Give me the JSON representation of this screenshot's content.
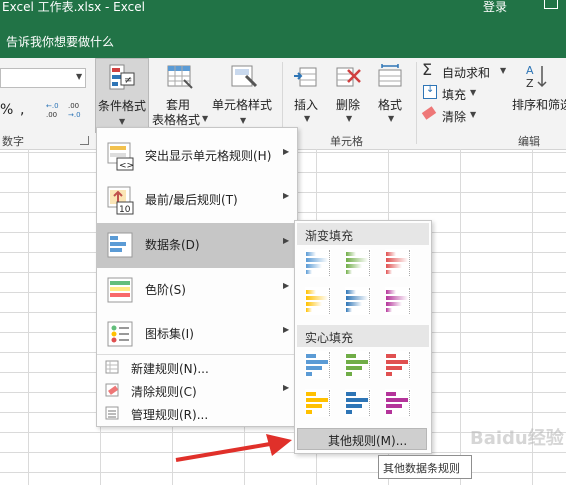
{
  "window": {
    "title": "Excel 工作表.xlsx  -  Excel",
    "login": "登录"
  },
  "tellme": {
    "text": "告诉我你想要做什么"
  },
  "ribbon": {
    "percent_symbol": "%",
    "comma_symbol": ",",
    "increase_decimal": "€.0\n.00",
    "decrease_decimal": ".00\n→.0",
    "number_group_label": "数字",
    "conditional_format": "条件格式",
    "apply_label_1": "套用",
    "apply_label_2": "表格格式",
    "cell_style": "单元格样式",
    "insert": "插入",
    "delete": "删除",
    "format": "格式",
    "cells_group_label": "单元格",
    "autosum": "自动求和",
    "fill": "填充",
    "clear": "清除",
    "sort_filter": "排序和筛选",
    "edit_group_label": "编辑"
  },
  "cf_menu": {
    "items": [
      {
        "label": "突出显示单元格规则(H)",
        "icon": "highlight-rules-icon"
      },
      {
        "label": "最前/最后规则(T)",
        "icon": "top-bottom-rules-icon"
      },
      {
        "label": "数据条(D)",
        "icon": "data-bars-icon",
        "highlighted": true
      },
      {
        "label": "色阶(S)",
        "icon": "color-scales-icon"
      },
      {
        "label": "图标集(I)",
        "icon": "icon-sets-icon"
      }
    ],
    "small_items": [
      {
        "label": "新建规则(N)...",
        "icon": "new-rule-icon"
      },
      {
        "label": "清除规则(C)",
        "icon": "clear-rules-icon"
      },
      {
        "label": "管理规则(R)...",
        "icon": "manage-rules-icon"
      }
    ]
  },
  "databar_sub": {
    "gradient_header": "渐变填充",
    "solid_header": "实心填充",
    "more_rules": "其他规则(M)...",
    "colors": [
      "#5b9bd5",
      "#70ad47",
      "#e05050",
      "#ffc000",
      "#2e75b6",
      "#b4349a"
    ]
  },
  "tooltip": {
    "text": "其他数据条规则"
  },
  "watermark": {
    "text": "Baidu经验"
  },
  "colors": {
    "excel_green": "#217346",
    "arrow_red": "#e0302a"
  }
}
